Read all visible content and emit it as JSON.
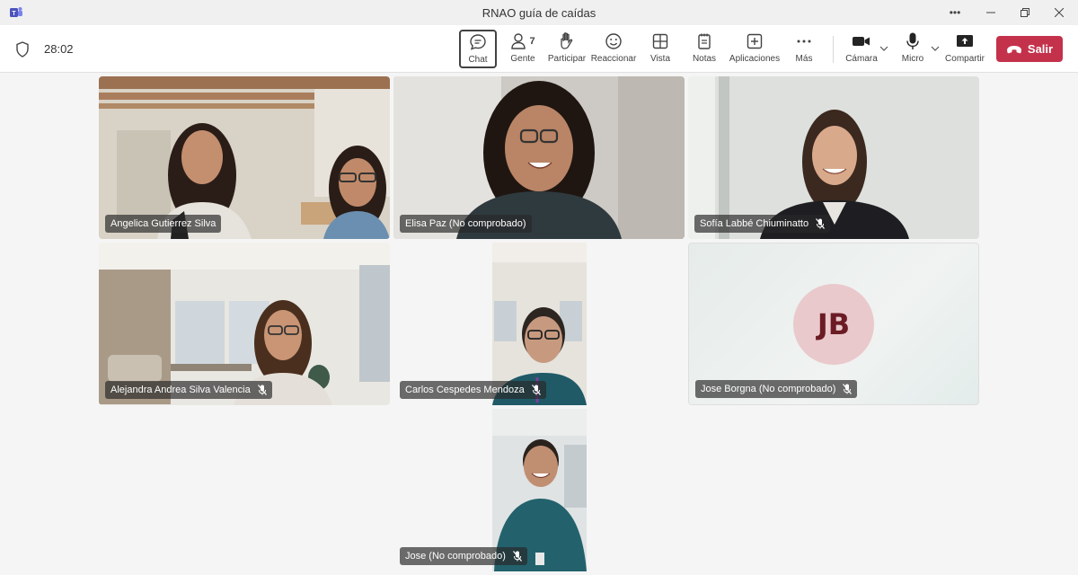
{
  "window": {
    "title": "RNAO guía de caídas"
  },
  "meeting": {
    "timer": "28:02"
  },
  "toolbar": {
    "chat": "Chat",
    "people": "Gente",
    "people_count": "7",
    "raise": "Participar",
    "react": "Reaccionar",
    "view": "Vista",
    "notes": "Notas",
    "apps": "Aplicaciones",
    "more": "Más",
    "camera": "Cámara",
    "mic": "Micro",
    "share": "Compartir",
    "leave": "Salir"
  },
  "participants": [
    {
      "name": "Angelica Gutierrez Silva",
      "muted": false
    },
    {
      "name": "Elisa Paz (No comprobado)",
      "muted": false
    },
    {
      "name": "Sofía Labbé Chiuminatto",
      "muted": true
    },
    {
      "name": "Alejandra Andrea Silva Valencia",
      "muted": true
    },
    {
      "name": "Carlos Cespedes Mendoza",
      "muted": true
    },
    {
      "name": "Jose Borgna (No comprobado)",
      "muted": true,
      "initials": "JB"
    },
    {
      "name": "Jose (No comprobado)",
      "muted": true
    }
  ],
  "colors": {
    "leave": "#c4314b",
    "avatar_bg": "#e9c9cc",
    "avatar_text": "#6b1b24"
  }
}
